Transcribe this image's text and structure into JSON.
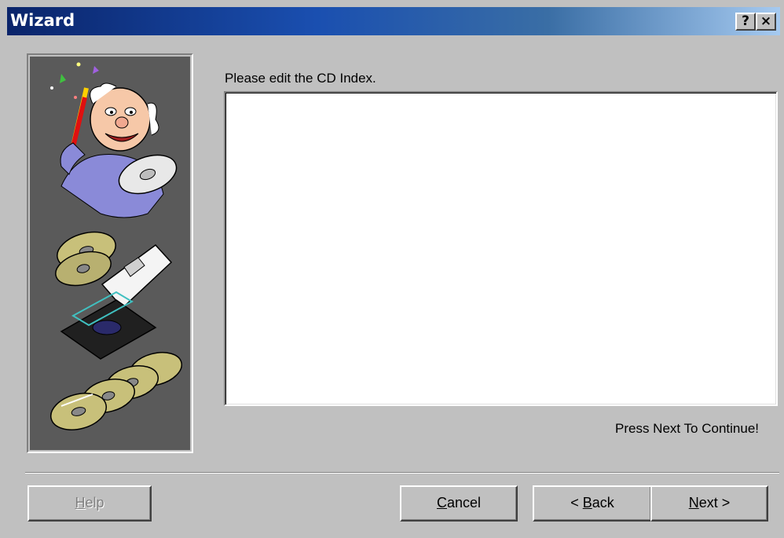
{
  "window": {
    "title": "Wizard",
    "title_buttons": {
      "help": "?",
      "close": "×"
    }
  },
  "content": {
    "prompt": "Please edit the CD Index.",
    "cd_index_value": "",
    "continue_hint": "Press Next To Continue!"
  },
  "buttons": {
    "help": {
      "label": "Help",
      "mnemonic": "H",
      "rest": "elp",
      "enabled": false
    },
    "cancel": {
      "label": "Cancel",
      "mnemonic": "C",
      "rest": "ancel"
    },
    "back": {
      "label": "< Back",
      "prefix": "< ",
      "mnemonic": "B",
      "rest": "ack"
    },
    "next": {
      "label": "Next >",
      "mnemonic": "N",
      "rest": "ext >"
    }
  },
  "illustration": {
    "panel_color": "#5a5a5a",
    "items": [
      "wizard-character-icon",
      "cd-case-icon",
      "cd-stack-icon"
    ]
  }
}
